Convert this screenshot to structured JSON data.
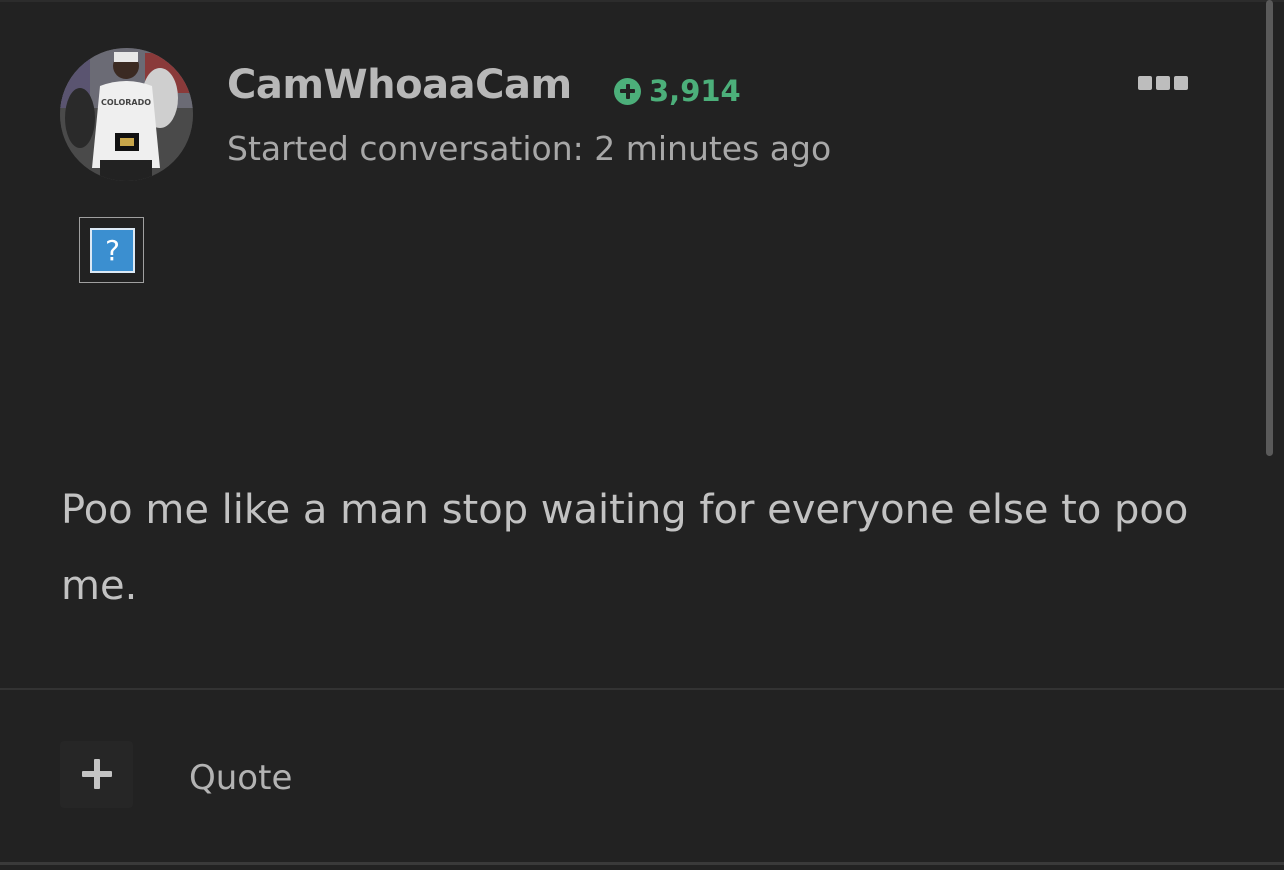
{
  "post": {
    "author": {
      "username": "CamWhoaaCam",
      "reputation": "3,914",
      "avatar_icon": "user-avatar-photo",
      "avatar_shirt_text": "COLORADO"
    },
    "meta": "Started conversation: 2 minutes ago",
    "broken_image_glyph": "?",
    "body": "Poo me like a man stop waiting for everyone else to poo me.",
    "actions": {
      "react_icon": "plus-icon",
      "quote_label": "Quote"
    },
    "menu_icon": "ellipsis-icon"
  },
  "colors": {
    "background": "#222222",
    "reputation_green": "#4caf7a",
    "text_primary": "#b8b8b8",
    "text_secondary": "#a8a8a8"
  }
}
